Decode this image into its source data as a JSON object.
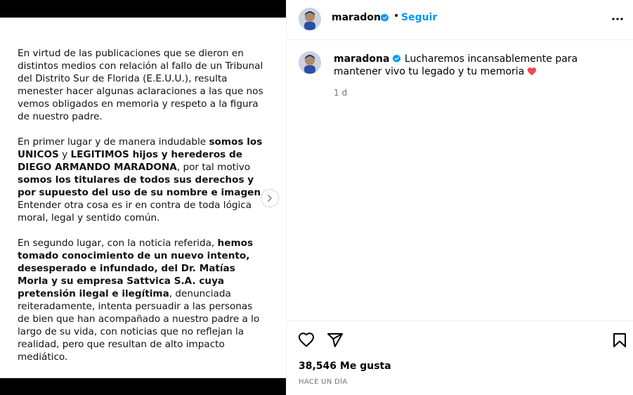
{
  "post": {
    "document": {
      "paragraph1": "En virtud de las publicaciones que se dieron en distintos medios con relación al fallo de un Tribunal del Distrito Sur de Florida (E.E.U.U.), resulta menester hacer algunas aclaraciones a las que nos vemos obligados en memoria y respeto a la figura de nuestro padre.",
      "p2_a": "En primer lugar y de manera indudable ",
      "p2_b": "somos los UNICOS",
      "p2_c": " y ",
      "p2_d": "LEGITIMOS hijos y herederos de DIEGO ARMANDO MARADONA",
      "p2_e": ", por tal motivo ",
      "p2_f": "somos los titulares de todos sus derechos y por supuesto del uso de su nombre e imagen",
      "p2_g": ". Entender otra cosa es ir en contra de toda lógica moral, legal y sentido común.",
      "p3_a": "En segundo lugar, con la noticia referida, ",
      "p3_b": "hemos tomado conocimiento de un nuevo intento, desesperado e infundado, del Dr. Matías Morla y su empresa Sattvica S.A. cuya pretensión ilegal e ilegítima",
      "p3_c": ", denunciada reiteradamente, intenta persuadir a las personas de bien que han acompañado a nuestro padre a lo largo de su vida, con noticias que no reflejan la realidad, pero que resultan de alto impacto mediático."
    }
  },
  "header": {
    "username": "maradona",
    "separator": "•",
    "follow_label": "Seguir"
  },
  "caption": {
    "username": "maradona",
    "text": "Lucharemos incansablemente para mantener vivo tu legado y tu memoria",
    "time": "1 d"
  },
  "footer": {
    "likes": "38,546 Me gusta",
    "posted_ago": "HACE UN DÍA"
  },
  "colors": {
    "link": "#0095f6",
    "verified": "#0095f6",
    "heart": "#ed4956"
  },
  "icons": [
    "chevron-right-icon",
    "verified-badge-icon",
    "more-options-icon",
    "heart-outline-icon",
    "share-icon",
    "bookmark-icon",
    "red-heart-emoji"
  ]
}
